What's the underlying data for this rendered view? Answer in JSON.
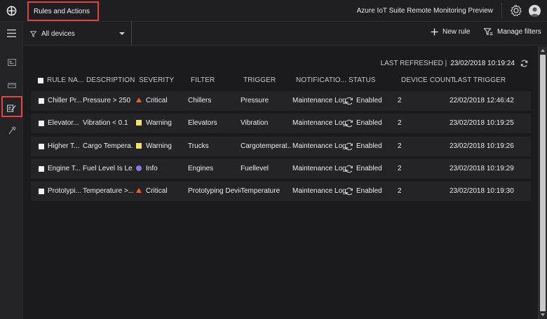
{
  "header": {
    "page_title": "Rules and Actions",
    "app_title": "Azure IoT Suite Remote Monitoring Preview",
    "logo_icon": "hub-logo-icon",
    "settings_icon": "gear-icon",
    "avatar_icon": "user-avatar-icon"
  },
  "rail": {
    "items": [
      {
        "name": "hamburger-menu",
        "icon": "hamburger-icon"
      },
      {
        "name": "dashboard",
        "icon": "dashboard-icon"
      },
      {
        "name": "devices",
        "icon": "devices-icon"
      },
      {
        "name": "rules",
        "icon": "rules-icon",
        "selected": true
      },
      {
        "name": "maintenance",
        "icon": "maintenance-icon"
      }
    ]
  },
  "subheader": {
    "device_filter": "All devices",
    "new_rule": "New rule",
    "manage_filters": "Manage filters"
  },
  "refresh": {
    "label": "LAST REFRESHED |",
    "value": "23/02/2018 10:19:24"
  },
  "table": {
    "columns": {
      "rule_name": "RULE NA...",
      "description": "DESCRIPTION",
      "severity": "SEVERITY",
      "filter": "FILTER",
      "trigger": "TRIGGER",
      "notifications": "NOTIFICATIO...",
      "status": "STATUS",
      "device_count": "DEVICE COUNT",
      "last_trigger": "LAST TRIGGER"
    },
    "rows": [
      {
        "rule_name": "Chiller Pr...",
        "description": "Pressure > 250",
        "severity": "Critical",
        "severity_kind": "critical",
        "filter": "Chillers",
        "trigger": "Pressure",
        "notifications": "Maintenance Log",
        "status": "Enabled",
        "device_count": "2",
        "last_trigger": "22/02/2018 12:46:42"
      },
      {
        "rule_name": "Elevator...",
        "description": "Vibration < 0.1",
        "severity": "Warning",
        "severity_kind": "warning",
        "filter": "Elevators",
        "trigger": "Vibration",
        "notifications": "Maintenance Log",
        "status": "Enabled",
        "device_count": "2",
        "last_trigger": "23/02/2018 10:19:25"
      },
      {
        "rule_name": "Higher T...",
        "description": "Cargo Tempera...",
        "severity": "Warning",
        "severity_kind": "warning",
        "filter": "Trucks",
        "trigger": "Cargotemperat...",
        "notifications": "Maintenance Log",
        "status": "Enabled",
        "device_count": "2",
        "last_trigger": "23/02/2018 10:19:26"
      },
      {
        "rule_name": "Engine T...",
        "description": "Fuel Level Is Le...",
        "severity": "Info",
        "severity_kind": "info",
        "filter": "Engines",
        "trigger": "Fuellevel",
        "notifications": "Maintenance Log",
        "status": "Enabled",
        "device_count": "2",
        "last_trigger": "23/02/2018 10:19:29"
      },
      {
        "rule_name": "Prototypi...",
        "description": "Temperature >...",
        "severity": "Critical",
        "severity_kind": "critical",
        "filter": "Prototyping Devic",
        "trigger": "Temperature",
        "notifications": "Maintenance Log",
        "status": "Enabled",
        "device_count": "2",
        "last_trigger": "23/02/2018 10:19:30"
      }
    ]
  },
  "colors": {
    "critical": "#e8622c",
    "warning": "#f4e06b",
    "info": "#8b74f0",
    "highlight": "#e2433d"
  }
}
